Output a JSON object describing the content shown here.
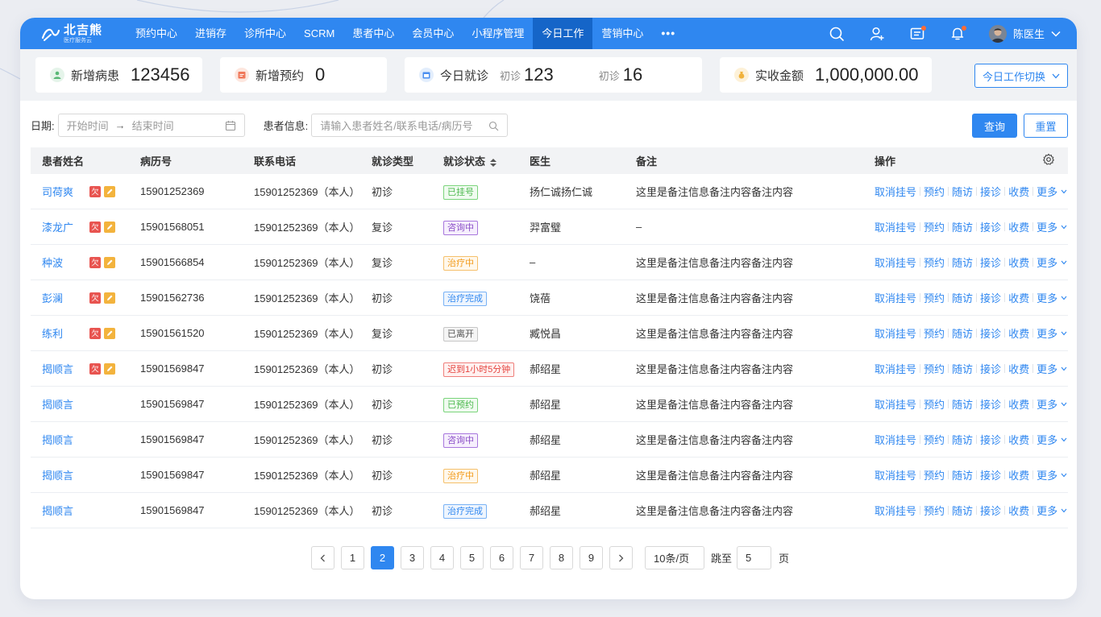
{
  "colors": {
    "primary": "#2f87f0",
    "nav_active": "#1565c8"
  },
  "nav": {
    "logo_name": "北吉熊",
    "logo_sub": "医疗服务云",
    "items": [
      "预约中心",
      "进销存",
      "诊所中心",
      "SCRM",
      "患者中心",
      "会员中心",
      "小程序管理",
      "今日工作",
      "营销中心"
    ],
    "active": "今日工作",
    "more": "•••",
    "user_name": "陈医生"
  },
  "stats": {
    "new_patients_label": "新增病患",
    "new_patients_value": "123456",
    "new_appointments_label": "新增预约",
    "new_appointments_value": "0",
    "today_visits_label": "今日就诊",
    "first_visit_label_1": "初诊",
    "first_visit_value_1": "123",
    "first_visit_label_2": "初诊",
    "first_visit_value_2": "16",
    "revenue_label": "实收金额",
    "revenue_value": "1,000,000.00",
    "switch_label": "今日工作切换"
  },
  "filters": {
    "date_label": "日期:",
    "start_placeholder": "开始时间",
    "arrow": "→",
    "end_placeholder": "结束时间",
    "patient_label": "患者信息:",
    "patient_placeholder": "请输入患者姓名/联系电话/病历号",
    "query_label": "查询",
    "reset_label": "重置"
  },
  "table": {
    "headers": {
      "name": "患者姓名",
      "record": "病历号",
      "phone": "联系电话",
      "type": "就诊类型",
      "status": "就诊状态",
      "doctor": "医生",
      "note": "备注",
      "ops": "操作"
    },
    "tag_q": "欠",
    "ops": [
      "取消挂号",
      "预约",
      "随访",
      "接诊",
      "收费",
      "更多"
    ],
    "rows": [
      {
        "name": "司荷爽",
        "tags": true,
        "record": "15901252369",
        "phone": "15901252369（本人）",
        "type": "初诊",
        "status": "已挂号",
        "status_color": "green",
        "doctor": "扬仁诚扬仁诚",
        "note": "这里是备注信息备注内容备注内容"
      },
      {
        "name": "漆龙广",
        "tags": true,
        "record": "15901568051",
        "phone": "15901252369（本人）",
        "type": "复诊",
        "status": "咨询中",
        "status_color": "purple",
        "doctor": "羿富璧",
        "note": "–"
      },
      {
        "name": "种波",
        "tags": true,
        "record": "15901566854",
        "phone": "15901252369（本人）",
        "type": "复诊",
        "status": "治疗中",
        "status_color": "orange",
        "doctor": "–",
        "note": "这里是备注信息备注内容备注内容"
      },
      {
        "name": "彭澜",
        "tags": true,
        "record": "15901562736",
        "phone": "15901252369（本人）",
        "type": "初诊",
        "status": "治疗完成",
        "status_color": "blue",
        "doctor": "饶蓓",
        "note": "这里是备注信息备注内容备注内容"
      },
      {
        "name": "练利",
        "tags": true,
        "record": "15901561520",
        "phone": "15901252369（本人）",
        "type": "复诊",
        "status": "已离开",
        "status_color": "grey",
        "doctor": "臧悦昌",
        "note": "这里是备注信息备注内容备注内容"
      },
      {
        "name": "揭顺言",
        "tags": true,
        "record": "15901569847",
        "phone": "15901252369（本人）",
        "type": "初诊",
        "status": "迟到1小时5分钟",
        "status_color": "red",
        "doctor": "郝绍星",
        "note": "这里是备注信息备注内容备注内容"
      },
      {
        "name": "揭顺言",
        "tags": false,
        "record": "15901569847",
        "phone": "15901252369（本人）",
        "type": "初诊",
        "status": "已预约",
        "status_color": "green",
        "doctor": "郝绍星",
        "note": "这里是备注信息备注内容备注内容"
      },
      {
        "name": "揭顺言",
        "tags": false,
        "record": "15901569847",
        "phone": "15901252369（本人）",
        "type": "初诊",
        "status": "咨询中",
        "status_color": "purple",
        "doctor": "郝绍星",
        "note": "这里是备注信息备注内容备注内容"
      },
      {
        "name": "揭顺言",
        "tags": false,
        "record": "15901569847",
        "phone": "15901252369（本人）",
        "type": "初诊",
        "status": "治疗中",
        "status_color": "orange",
        "doctor": "郝绍星",
        "note": "这里是备注信息备注内容备注内容"
      },
      {
        "name": "揭顺言",
        "tags": false,
        "record": "15901569847",
        "phone": "15901252369（本人）",
        "type": "初诊",
        "status": "治疗完成",
        "status_color": "blue",
        "doctor": "郝绍星",
        "note": "这里是备注信息备注内容备注内容"
      }
    ]
  },
  "pagination": {
    "pages": [
      "1",
      "2",
      "3",
      "4",
      "5",
      "6",
      "7",
      "8",
      "9"
    ],
    "current": "2",
    "page_size": "10条/页",
    "jump_label": "跳至",
    "jump_value": "5",
    "jump_unit": "页"
  }
}
